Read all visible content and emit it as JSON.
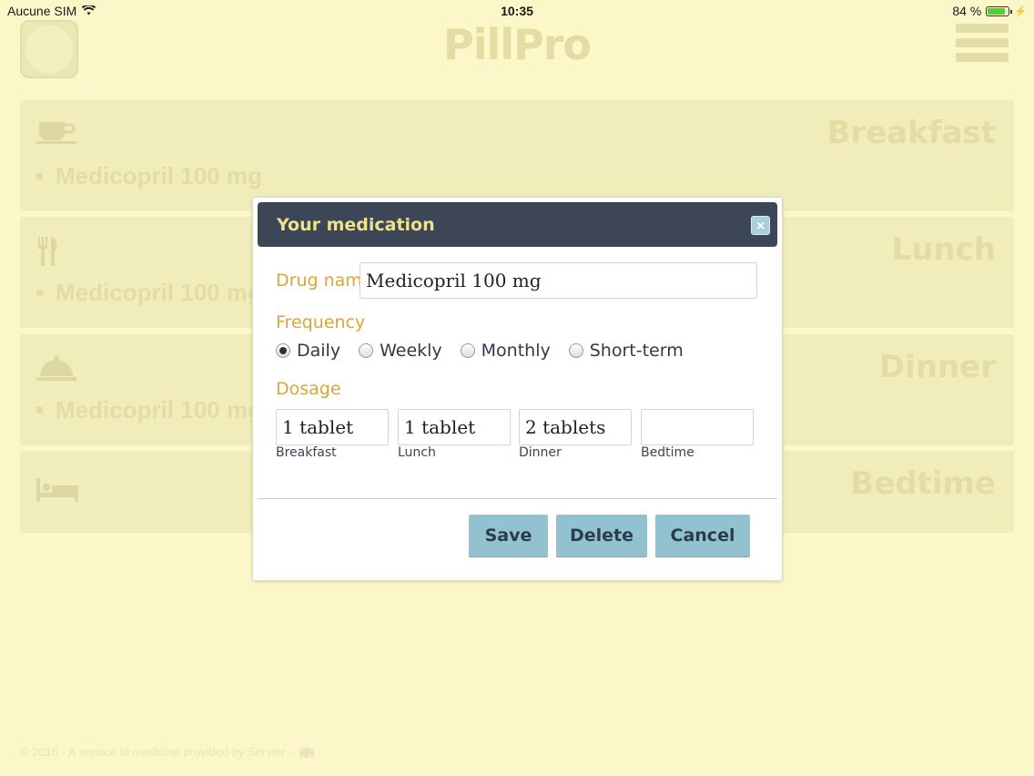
{
  "status": {
    "carrier": "Aucune SIM",
    "time": "10:35",
    "battery": "84 %",
    "battery_fraction": 0.84
  },
  "app": {
    "title": "PillPro"
  },
  "meals": [
    {
      "title": "Breakfast",
      "icon": "cup-icon",
      "items": [
        "Medicopril 100 mg"
      ]
    },
    {
      "title": "Lunch",
      "icon": "fork-knife-icon",
      "items": [
        "Medicopril 100 mg"
      ]
    },
    {
      "title": "Dinner",
      "icon": "cloche-icon",
      "items": [
        "Medicopril 100 mg"
      ]
    },
    {
      "title": "Bedtime",
      "icon": "bed-icon",
      "items": []
    }
  ],
  "footer": {
    "text": "© 2016 - A service to medicine provided by Servier -"
  },
  "modal": {
    "title": "Your medication",
    "close_label": "×",
    "drug_name_label": "Drug name",
    "drug_name_value": "Medicopril 100 mg",
    "frequency_label": "Frequency",
    "frequency_options": [
      "Daily",
      "Weekly",
      "Monthly",
      "Short-term"
    ],
    "frequency_selected": "Daily",
    "dosage_label": "Dosage",
    "dosage": [
      {
        "label": "Breakfast",
        "value": "1 tablet"
      },
      {
        "label": "Lunch",
        "value": "1 tablet"
      },
      {
        "label": "Dinner",
        "value": "2 tablets"
      },
      {
        "label": "Bedtime",
        "value": ""
      }
    ],
    "buttons": {
      "save": "Save",
      "delete": "Delete",
      "cancel": "Cancel"
    }
  }
}
